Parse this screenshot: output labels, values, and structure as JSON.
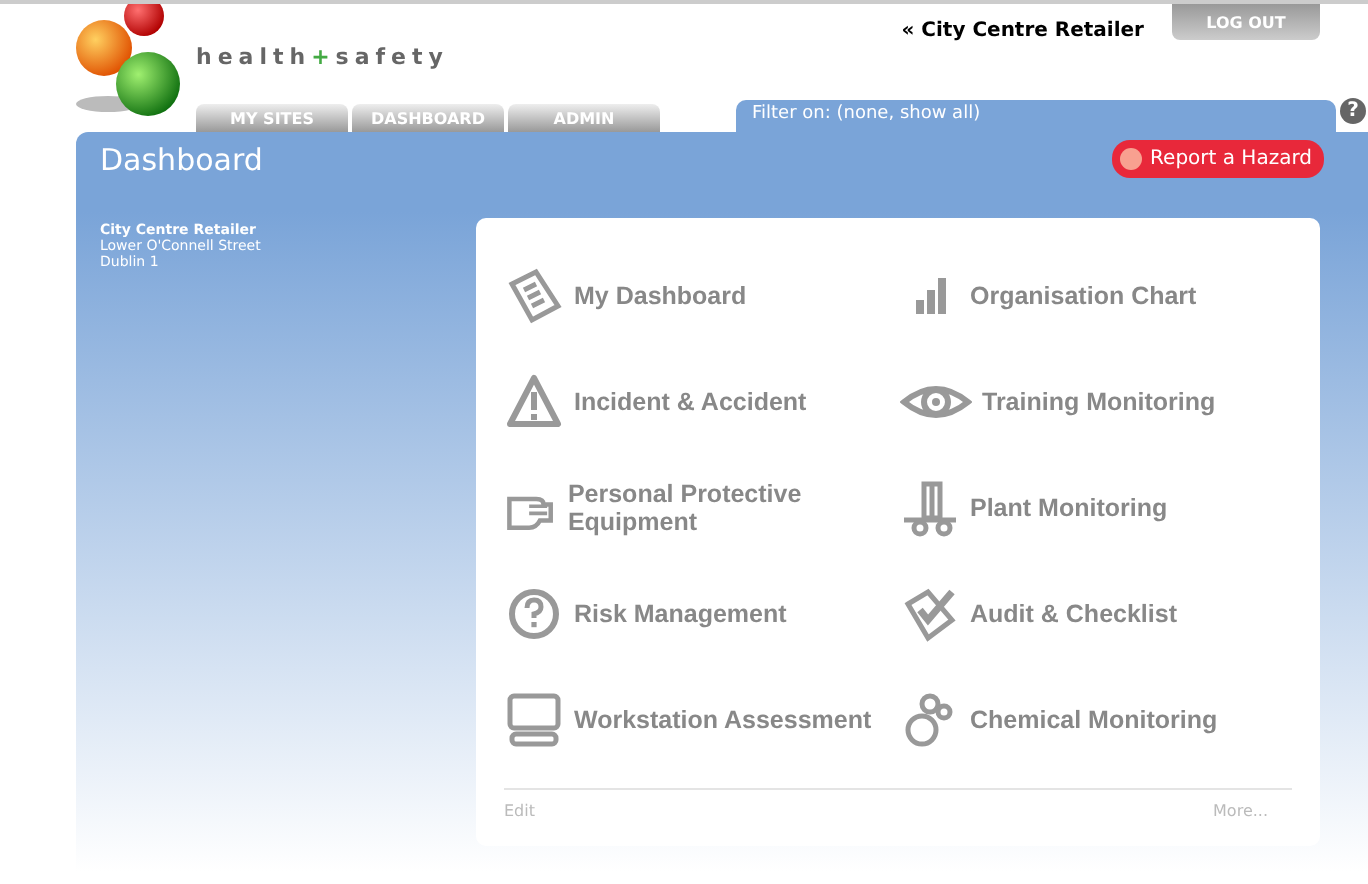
{
  "header": {
    "brand_left": "health",
    "brand_plus": "+",
    "brand_right": "safety",
    "site_link": "« City Centre Retailer",
    "logout": "LOG OUT"
  },
  "tabs": [
    {
      "label": "MY SITES",
      "selected": false
    },
    {
      "label": "DASHBOARD",
      "selected": false
    },
    {
      "label": "ADMIN",
      "selected": false
    }
  ],
  "filter": {
    "label": "Filter on: (none, show all)"
  },
  "help": "?",
  "panel": {
    "title": "Dashboard",
    "report_button": "Report a Hazard"
  },
  "address": {
    "name": "City Centre Retailer",
    "street": "Lower O'Connell Street",
    "city": "Dublin 1"
  },
  "tiles": [
    {
      "label": "My Dashboard",
      "kind": "clipboard"
    },
    {
      "label": "Organisation Chart",
      "kind": "bars"
    },
    {
      "label": "Incident & Accident",
      "kind": "warning"
    },
    {
      "label": "Training Monitoring",
      "kind": "eye"
    },
    {
      "label": "Personal Protective Equipment",
      "kind": "glove"
    },
    {
      "label": "Plant Monitoring",
      "kind": "trolley"
    },
    {
      "label": "Risk Management",
      "kind": "question"
    },
    {
      "label": "Audit & Checklist",
      "kind": "checklist"
    },
    {
      "label": "Workstation Assessment",
      "kind": "monitor"
    },
    {
      "label": "Chemical Monitoring",
      "kind": "bubbles"
    }
  ],
  "footer": {
    "edit": "Edit",
    "more": "More..."
  }
}
